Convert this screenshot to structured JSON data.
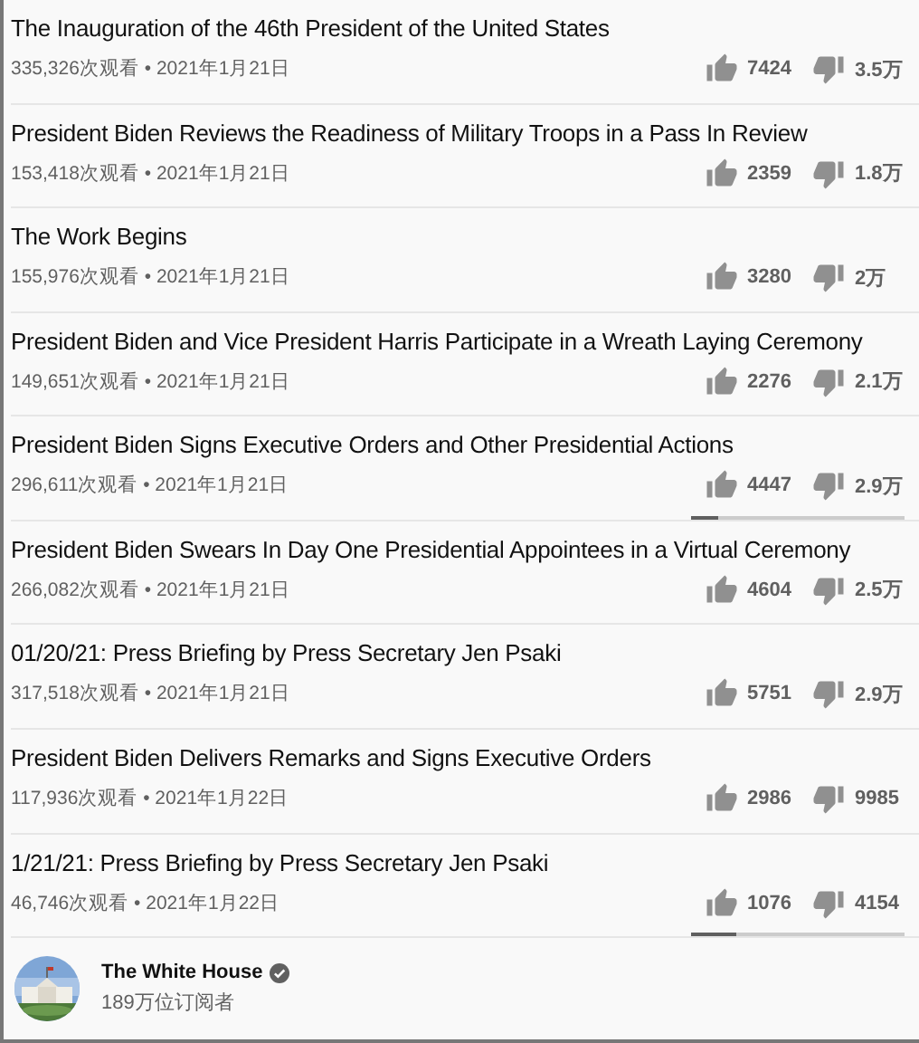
{
  "videos": [
    {
      "title": "The Inauguration of the 46th President of the United States",
      "meta": "335,326次观看 • 2021年1月21日",
      "likes": "7424",
      "dislikes": "3.5万"
    },
    {
      "title": "President Biden Reviews the Readiness of Military Troops in a Pass In Review",
      "meta": "153,418次观看 • 2021年1月21日",
      "likes": "2359",
      "dislikes": "1.8万"
    },
    {
      "title": "The Work Begins",
      "meta": "155,976次观看 • 2021年1月21日",
      "likes": "3280",
      "dislikes": "2万"
    },
    {
      "title": "President Biden and Vice President Harris Participate in a Wreath Laying Ceremony",
      "meta": "149,651次观看 • 2021年1月21日",
      "likes": "2276",
      "dislikes": "2.1万"
    },
    {
      "title": "President Biden Signs Executive Orders and Other Presidential Actions",
      "meta": "296,611次观看 • 2021年1月21日",
      "likes": "4447",
      "dislikes": "2.9万",
      "level": 0.13
    },
    {
      "title": "President Biden Swears In Day One Presidential Appointees in a Virtual Ceremony",
      "meta": "266,082次观看 • 2021年1月21日",
      "likes": "4604",
      "dislikes": "2.5万"
    },
    {
      "title": "01/20/21: Press Briefing by Press Secretary Jen Psaki",
      "meta": "317,518次观看 • 2021年1月21日",
      "likes": "5751",
      "dislikes": "2.9万"
    },
    {
      "title": "President Biden Delivers Remarks and Signs Executive Orders",
      "meta": "117,936次观看 • 2021年1月22日",
      "likes": "2986",
      "dislikes": "9985"
    },
    {
      "title": "1/21/21: Press Briefing by Press Secretary Jen Psaki",
      "meta": "46,746次观看 • 2021年1月22日",
      "likes": "1076",
      "dislikes": "4154",
      "level": 0.21
    }
  ],
  "channel": {
    "name": "The White House",
    "verified": true,
    "subscribers": "189万位订阅者"
  }
}
